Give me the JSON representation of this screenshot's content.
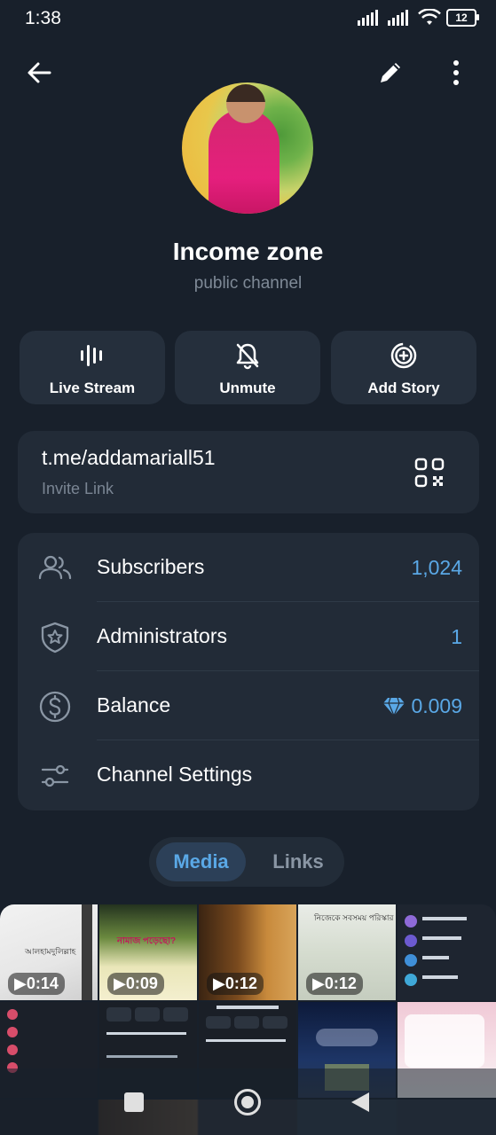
{
  "status": {
    "time": "1:38",
    "battery": "12"
  },
  "channel": {
    "name": "Income zone",
    "type": "public channel"
  },
  "actions": [
    {
      "label": "Live Stream",
      "icon": "live-stream-icon"
    },
    {
      "label": "Unmute",
      "icon": "bell-off-icon"
    },
    {
      "label": "Add Story",
      "icon": "add-story-icon"
    }
  ],
  "link": {
    "url": "t.me/addamariall51",
    "label": "Invite Link"
  },
  "info": {
    "subscribers": {
      "label": "Subscribers",
      "value": "1,024"
    },
    "administrators": {
      "label": "Administrators",
      "value": "1"
    },
    "balance": {
      "label": "Balance",
      "value": "0.009"
    },
    "settings": {
      "label": "Channel Settings"
    }
  },
  "tabs": {
    "media": "Media",
    "links": "Links",
    "active": "Media"
  },
  "media": [
    {
      "duration": "0:14",
      "caption": "আলহামদুলিল্লাহ"
    },
    {
      "duration": "0:09",
      "caption": "নামাজ পড়েছো?"
    },
    {
      "duration": "0:12",
      "caption": ""
    },
    {
      "duration": "0:12",
      "caption": "নিজেকে সবসময় পরিস্কার"
    },
    {
      "duration": "",
      "caption": ""
    }
  ],
  "colors": {
    "background": "#18202b",
    "card": "#222b37",
    "accent": "#5aa8e6"
  }
}
